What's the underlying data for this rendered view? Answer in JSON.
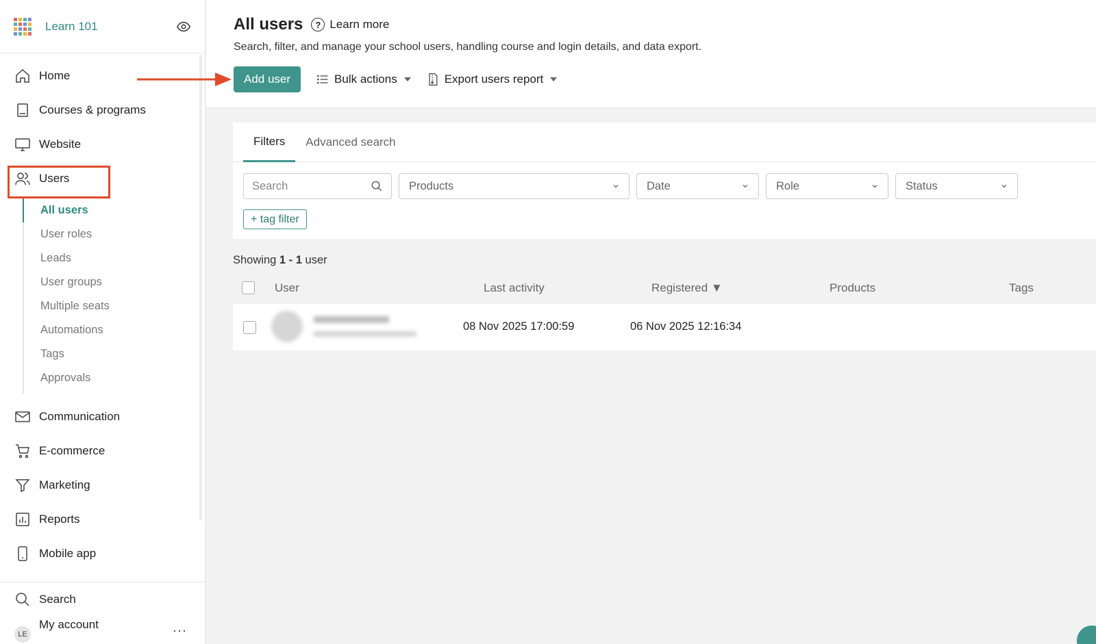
{
  "brand": {
    "name": "Learn 101"
  },
  "sidebar": {
    "items_top": [
      {
        "label": "Home"
      },
      {
        "label": "Courses & programs"
      },
      {
        "label": "Website"
      },
      {
        "label": "Users"
      }
    ],
    "sub_items": [
      {
        "label": "All users"
      },
      {
        "label": "User roles"
      },
      {
        "label": "Leads"
      },
      {
        "label": "User groups"
      },
      {
        "label": "Multiple seats"
      },
      {
        "label": "Automations"
      },
      {
        "label": "Tags"
      },
      {
        "label": "Approvals"
      }
    ],
    "items_bottom": [
      {
        "label": "Communication"
      },
      {
        "label": "E-commerce"
      },
      {
        "label": "Marketing"
      },
      {
        "label": "Reports"
      },
      {
        "label": "Mobile app"
      }
    ],
    "search_label": "Search",
    "account_label": "My account",
    "avatar_initials": "LE"
  },
  "header": {
    "title": "All users",
    "learn_more": "Learn more",
    "subtitle": "Search, filter, and manage your school users, handling course and login details, and data export.",
    "add_user": "Add user",
    "bulk_actions": "Bulk actions",
    "export_report": "Export users report"
  },
  "filters": {
    "tabs": [
      {
        "label": "Filters"
      },
      {
        "label": "Advanced search"
      }
    ],
    "search_placeholder": "Search",
    "selects": [
      {
        "label": "Products"
      },
      {
        "label": "Date"
      },
      {
        "label": "Role"
      },
      {
        "label": "Status"
      }
    ],
    "tag_filter": "+ tag filter"
  },
  "results": {
    "showing_prefix": "Showing",
    "range": "1 - 1",
    "suffix": "user",
    "columns": {
      "user": "User",
      "last_activity": "Last activity",
      "registered": "Registered ▼",
      "products": "Products",
      "tags": "Tags"
    },
    "rows": [
      {
        "last_activity": "08 Nov 2025 17:00:59",
        "registered": "06 Nov 2025 12:16:34",
        "products": "",
        "tags": ""
      }
    ]
  },
  "colors": {
    "accent": "#3f958c",
    "highlight": "#e04a2a"
  }
}
